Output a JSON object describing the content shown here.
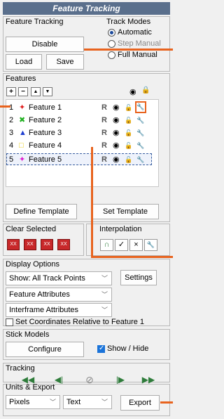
{
  "window": {
    "title": "Feature Tracking"
  },
  "feature_tracking": {
    "label": "Feature Tracking",
    "disable": "Disable",
    "load": "Load",
    "save": "Save"
  },
  "track_modes": {
    "label": "Track Modes",
    "options": [
      "Automatic",
      "Step Manual",
      "Full Manual"
    ],
    "selected": "Automatic"
  },
  "features": {
    "label": "Features",
    "toolbar": {
      "add": "+",
      "remove": "−",
      "up": "▲",
      "down": "▼",
      "eye": "◉",
      "lock": "🔒"
    },
    "items": [
      {
        "num": "1",
        "marker": "✦",
        "color": "#e02020",
        "name": "Feature 1",
        "r": "R",
        "eye": "◉",
        "lock": "🔓",
        "wrench": "🔧"
      },
      {
        "num": "2",
        "marker": "✖",
        "color": "#20b020",
        "name": "Feature 2",
        "r": "R",
        "eye": "◉",
        "lock": "🔓",
        "wrench": "🔧"
      },
      {
        "num": "3",
        "marker": "▲",
        "color": "#1f3fd0",
        "name": "Feature 3",
        "r": "R",
        "eye": "◉",
        "lock": "🔓",
        "wrench": "🔧"
      },
      {
        "num": "4",
        "marker": "□",
        "color": "#e8c800",
        "name": "Feature 4",
        "r": "R",
        "eye": "◉",
        "lock": "🔓",
        "wrench": "🔧"
      },
      {
        "num": "5",
        "marker": "✦",
        "color": "#e020d0",
        "name": "Feature 5",
        "r": "R",
        "eye": "◉",
        "lock": "🔓",
        "wrench": "🔧"
      }
    ],
    "define_template": "Define Template",
    "set_template": "Set Template"
  },
  "clear_selected": {
    "label": "Clear Selected",
    "buttons": [
      "XX",
      "XX",
      "XX",
      "XX"
    ]
  },
  "interpolation": {
    "label": "Interpolation",
    "buttons": [
      "∩",
      "✓",
      "×",
      "🔧"
    ]
  },
  "display_options": {
    "label": "Display Options",
    "show": "Show: All Track Points",
    "settings": "Settings",
    "feature_attrs": "Feature Attributes",
    "interframe_attrs": "Interframe Attributes",
    "relative_label": "Set Coordinates Relative to Feature 1",
    "relative_checked": false
  },
  "stick_models": {
    "label": "Stick Models",
    "configure": "Configure",
    "show_hide": "Show / Hide",
    "show_hide_checked": true
  },
  "tracking": {
    "label": "Tracking",
    "buttons": [
      "◀◀",
      "◀|",
      "⊘",
      "|▶",
      "▶▶"
    ]
  },
  "units_export": {
    "label": "Units & Export",
    "units": "Pixels",
    "format": "Text",
    "export": "Export"
  },
  "colors": {
    "title_bar": "#5a6f8c",
    "callout": "#e8631e",
    "accent": "#1a73d9"
  }
}
